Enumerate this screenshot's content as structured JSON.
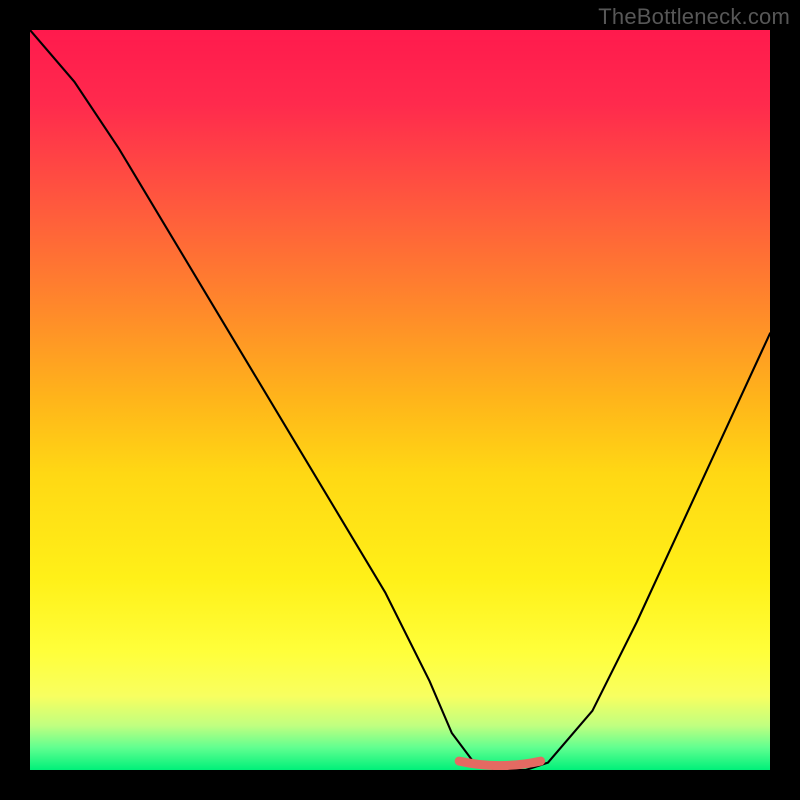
{
  "watermark": "TheBottleneck.com",
  "chart_data": {
    "type": "line",
    "title": "",
    "xlabel": "",
    "ylabel": "",
    "xlim": [
      0,
      100
    ],
    "ylim": [
      0,
      100
    ],
    "series": [
      {
        "name": "bottleneck-curve",
        "x": [
          0,
          6,
          12,
          18,
          24,
          30,
          36,
          42,
          48,
          54,
          57,
          60,
          63,
          67,
          70,
          76,
          82,
          88,
          94,
          100
        ],
        "values": [
          100,
          93,
          84,
          74,
          64,
          54,
          44,
          34,
          24,
          12,
          5,
          1,
          0,
          0,
          1,
          8,
          20,
          33,
          46,
          59
        ]
      }
    ],
    "annotations": [
      {
        "name": "minimum-marker",
        "x_start": 58,
        "x_end": 69,
        "y": 0.8
      }
    ],
    "background_gradient": {
      "orientation": "vertical",
      "stops": [
        {
          "pos": 0.0,
          "color": "#ff1a4d"
        },
        {
          "pos": 0.24,
          "color": "#ff5a3d"
        },
        {
          "pos": 0.5,
          "color": "#ffb51a"
        },
        {
          "pos": 0.74,
          "color": "#fff018"
        },
        {
          "pos": 0.9,
          "color": "#f8ff60"
        },
        {
          "pos": 1.0,
          "color": "#00f07a"
        }
      ]
    }
  }
}
